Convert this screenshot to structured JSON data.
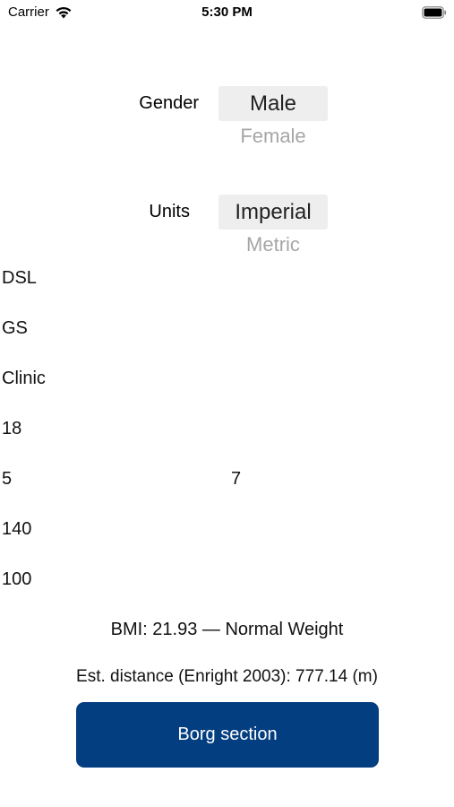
{
  "status_bar": {
    "carrier": "Carrier",
    "time": "5:30 PM",
    "wifi_icon": "wifi-icon",
    "battery_icon": "battery-icon"
  },
  "gender": {
    "label": "Gender",
    "selected": "Male",
    "other": "Female"
  },
  "units": {
    "label": "Units",
    "selected": "Imperial",
    "other": "Metric"
  },
  "fields": {
    "dsl": "DSL",
    "gs": "GS",
    "clinic": "Clinic",
    "age": "18",
    "height_ft": "5",
    "height_in": "7",
    "weight": "140",
    "value_100": "100"
  },
  "results": {
    "bmi": "BMI: 21.93 — Normal Weight",
    "distance": "Est. distance (Enright 2003): 777.14 (m)"
  },
  "borg_button": {
    "label": "Borg section",
    "color": "#033e80"
  }
}
